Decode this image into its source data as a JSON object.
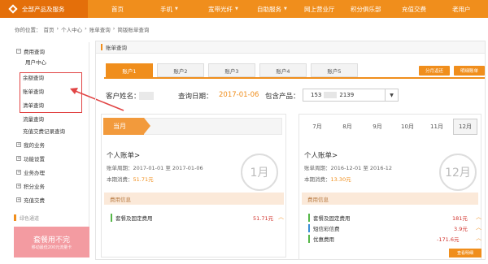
{
  "nav": {
    "all_products": "全部产品及服务",
    "items": [
      {
        "label": "首页",
        "dropdown": false
      },
      {
        "label": "手机",
        "dropdown": true
      },
      {
        "label": "宽带光纤",
        "dropdown": true
      },
      {
        "label": "自助服务",
        "dropdown": true
      },
      {
        "label": "网上营业厅",
        "dropdown": false
      },
      {
        "label": "积分俱乐部",
        "dropdown": false
      },
      {
        "label": "充值交费",
        "dropdown": false
      },
      {
        "label": "老用户",
        "dropdown": false
      }
    ]
  },
  "breadcrumb": [
    "你的位置：",
    "首页",
    "›",
    "个人中心",
    "›",
    "账单查询",
    "›",
    "简版账单查询"
  ],
  "sidebar": {
    "section1": "费用查询",
    "section1_items": [
      "用户中心",
      "余额查询",
      "账单查询",
      "清单查询",
      "流量查询",
      "充值交费记录查询"
    ],
    "sections": [
      "我的业务",
      "功能设置",
      "业务办理",
      "积分业务",
      "充值交费"
    ],
    "green_channel": "绿色通道",
    "promo_title": "套餐用不完",
    "promo_sub": "移动最低200元流量卡"
  },
  "main": {
    "panel_title": "账单查询",
    "account_tabs": [
      "账户1",
      "账户2",
      "账户3",
      "账户4",
      "账户5"
    ],
    "active_tab": 0,
    "btn_monthly": "分月返还",
    "btn_detail": "明细账单",
    "customer_label": "客户姓名：",
    "query_date_label": "查询日期：",
    "query_date": "2017-01-06",
    "product_label": "包含产品：",
    "product_prefix": "153",
    "product_suffix": "2139",
    "left_card": {
      "current_tag": "当月",
      "bill_title": "个人账单>",
      "period_label": "账单周期：",
      "period": "2017-01-01 至 2017-01-06",
      "consume_label": "本期消费：",
      "consume": "51.71元",
      "circle": "1月",
      "fee_info": "费用信息",
      "fees": [
        {
          "name": "套餐及固定费用",
          "value": "51.71元",
          "color": "#56b748"
        }
      ]
    },
    "months": [
      "7月",
      "8月",
      "9月",
      "10月",
      "11月",
      "12月"
    ],
    "selected_month": 5,
    "right_card": {
      "bill_title": "个人账单>",
      "period_label": "账单周期：",
      "period": "2016-12-01 至 2016-12",
      "consume_label": "本期消费：",
      "consume": "13.30元",
      "circle": "12月",
      "fee_info": "费用信息",
      "fees": [
        {
          "name": "套餐及固定费用",
          "value": "181元",
          "color": "#56b748"
        },
        {
          "name": "短信彩信费",
          "value": "3.9元",
          "color": "#3a8ed6"
        },
        {
          "name": "优惠费用",
          "value": "-171.6元",
          "color": "#56b748"
        }
      ],
      "detail_button": "查看明细"
    }
  },
  "colors": {
    "brand": "#f08e1c",
    "brand_dark": "#e46f0a",
    "highlight_box": "#e14444"
  }
}
